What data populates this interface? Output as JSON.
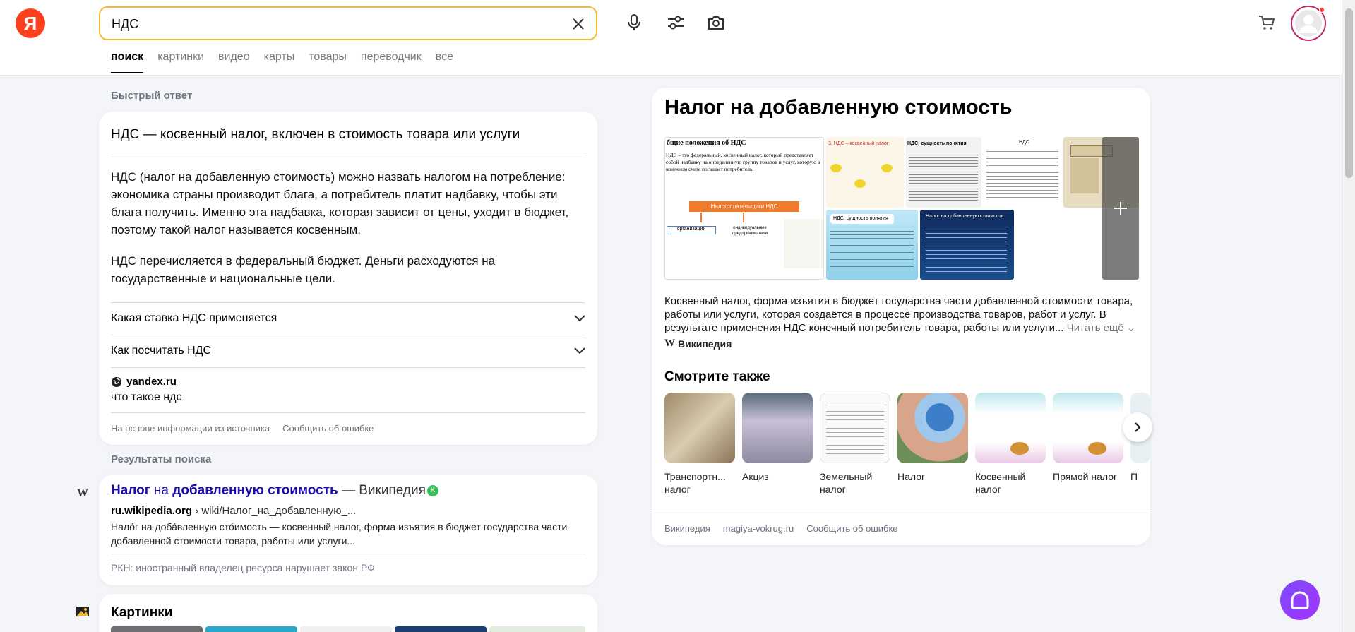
{
  "header": {
    "search_value": "НДС",
    "tabs": [
      "поиск",
      "картинки",
      "видео",
      "карты",
      "товары",
      "переводчик",
      "все"
    ],
    "logo_letter": "Я",
    "accent_color": "#f5b82f"
  },
  "quick_answer": {
    "section_label": "Быстрый ответ",
    "title": "НДС — косвенный налог, включен в стоимость товара или услуги",
    "paragraph1": "НДС (налог на добавленную стоимость) можно назвать налогом на потребление: экономика страны производит блага, а потребитель платит надбавку, чтобы эти блага получить. Именно эта надбавка, которая зависит от цены, уходит в бюджет, поэтому такой налог называется косвенным.",
    "paragraph2": "НДС перечисляется в федеральный бюджет. Деньги расходуются на государственные и национальные цели.",
    "accordion": [
      "Какая ставка НДС применяется",
      "Как посчитать НДС"
    ],
    "source_site": "yandex.ru",
    "source_query": "что такое ндс",
    "footer_links": [
      "На основе информации из источника",
      "Сообщить об ошибке"
    ]
  },
  "results": {
    "section_label": "Результаты поиска",
    "item": {
      "title_part1": "Налог",
      "title_part2": " на ",
      "title_part3": "добавленную стоимость",
      "title_part4": " — Википедия",
      "badge": "K",
      "url_domain": "ru.wikipedia.org",
      "url_path": " › wiki/Налог_на_добавленную_...",
      "snippet": "Нало́г на доба́вленную сто́имость — косвенный налог, форма изъятия в бюджет государства части добавленной стоимости товара, работы или услуги...",
      "warning": "РКН: иностранный владелец ресурса нарушает закон РФ"
    }
  },
  "images_block": {
    "title": "Картинки"
  },
  "knowledge": {
    "title": "Налог на добавленную стоимость",
    "description": "Косвенный налог, форма изъятия в бюджет государства части добавленной стоимости товара, работы или услуги, которая создаётся в процессе производства товаров, работ и услуг. В результате применения НДС конечный потребитель товара, работы или услуги...",
    "read_more": "Читать ещё",
    "source": "Википедия",
    "gallery_texts": {
      "t1_heading": "бщие положения об НДС",
      "t1_body": "НДС – это федеральный, косвенный налог, который представляет собой надбавку на определенную группу товаров и услуг, которую в конечном счете погашает потребитель.",
      "t1_box": "Налогоплательщики НДС",
      "t1_leaf1": "организации",
      "t1_leaf2": "индивидуальные предприниматели",
      "t2_heading": "3. НДС – косвенный налог",
      "t3_heading": "НДС: сущность понятия",
      "t4_heading": "НДС",
      "t5_heading": "НДС: сущность понятия",
      "t6_heading": "Налог на добавленную стоимость"
    },
    "see_also_title": "Смотрите также",
    "see_also": [
      {
        "label": "Транспортн... налог"
      },
      {
        "label": "Акциз"
      },
      {
        "label": "Земельный налог"
      },
      {
        "label": "Налог"
      },
      {
        "label": "Косвенный налог"
      },
      {
        "label": "Прямой налог"
      },
      {
        "label": "П"
      }
    ],
    "footer_links": [
      "Википедия",
      "magiya-vokrug.ru",
      "Сообщить об ошибке"
    ]
  }
}
